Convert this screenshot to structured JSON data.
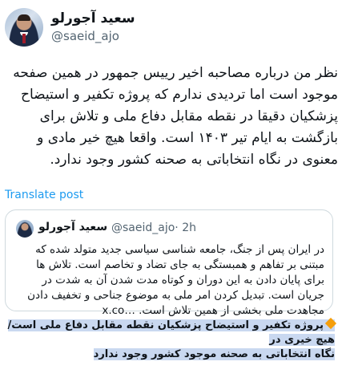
{
  "author": {
    "display_name": "سعید آجورلو",
    "handle": "@saeid_ajo"
  },
  "tweet": {
    "text": "نظر من درباره مصاحبه اخیر رییس جمهور در همین صفحه موجود است اما تردیدی ندارم که پروژه تکفیر و استیضاح پزشکیان دقیقا در نقطه مقابل دفاع ملی و تلاش برای بازگشت به ایام تیر ۱۴۰۳ است. واقعا هیچ خیر مادی و معنوی در نگاه انتخاباتی به صحنه کشور وجود ندارد.",
    "translate_label": "Translate post"
  },
  "quote": {
    "display_name": "سعید آجورلو",
    "handle": "@saeid_ajo",
    "time": "· 2h",
    "text": "در ایران پس از جنگ، جامعه شناسی سیاسی جدید متولد شده که مبتنی بر تفاهم و همبستگی به جای تضاد و تخاصم است. تلاش ها برای پایان دادن به این دوران و کوتاه مدت شدن آن به شدت در جریان است. تبدیل کردن امر ملی به موضوع جناحی و تخفیف دادن مجاهدت ملی بخشی از همین تلاش است. …x.co"
  },
  "highlight": {
    "icon": "orange-diamond-icon",
    "color": "#c9d8f0",
    "line1": "پروژه تکفیر و استیضاح پزشکیان نقطه مقابل دفاع ملی است/ هیچ خیری در",
    "line2": "نگاه انتخاباتی به صحنه موجود کشور وجود ندارد"
  }
}
